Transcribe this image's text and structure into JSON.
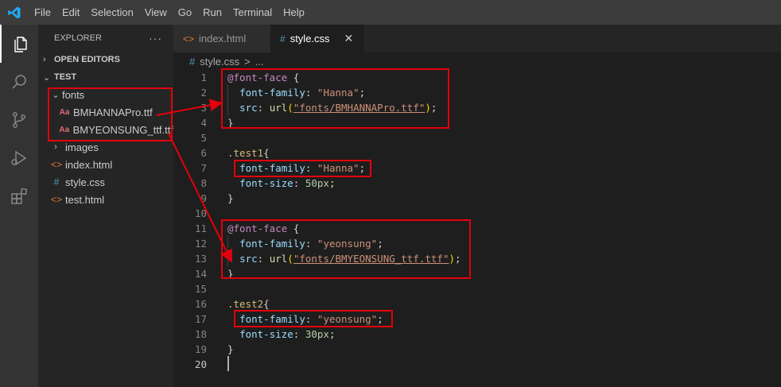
{
  "menu": [
    "File",
    "Edit",
    "Selection",
    "View",
    "Go",
    "Run",
    "Terminal",
    "Help"
  ],
  "sidebar": {
    "title": "EXPLORER",
    "more": "···",
    "open_editors": "OPEN EDITORS",
    "root": "TEST",
    "tree": [
      {
        "label": "fonts",
        "type": "folder-open",
        "depth": 1
      },
      {
        "label": "BMHANNAPro.ttf",
        "type": "font",
        "depth": 2
      },
      {
        "label": "BMYEONSUNG_ttf.ttf",
        "type": "font",
        "depth": 2
      },
      {
        "label": "images",
        "type": "folder",
        "depth": 1
      },
      {
        "label": "index.html",
        "type": "html",
        "depth": 1
      },
      {
        "label": "style.css",
        "type": "css",
        "depth": 1
      },
      {
        "label": "test.html",
        "type": "html",
        "depth": 1
      }
    ]
  },
  "tabs": [
    {
      "label": "index.html",
      "icon": "<>",
      "active": false
    },
    {
      "label": "style.css",
      "icon": "#",
      "active": true
    }
  ],
  "breadcrumb": {
    "file": "style.css",
    "sep": ">",
    "rest": "..."
  },
  "code": {
    "ff_at": "@font-face",
    "ff_prop": "font-family",
    "src_prop": "src",
    "url_fn": "url",
    "hanna": "\"Hanna\"",
    "hanna_path": "\"fonts/BMHANNAPro.ttf\"",
    "yeonsung": "\"yeonsung\"",
    "yeonsung_path": "\"fonts/BMYEONSUNG_ttf.ttf\"",
    "sel1": ".test1",
    "sel2": ".test2",
    "fs_prop": "font-size",
    "fs1": "50px",
    "fs2": "30px"
  },
  "line_numbers": [
    "1",
    "2",
    "3",
    "4",
    "5",
    "6",
    "7",
    "8",
    "9",
    "10",
    "11",
    "12",
    "13",
    "14",
    "15",
    "16",
    "17",
    "18",
    "19",
    "20"
  ],
  "colors": {
    "annotation": "#e3000b",
    "accent": "#007acc"
  }
}
